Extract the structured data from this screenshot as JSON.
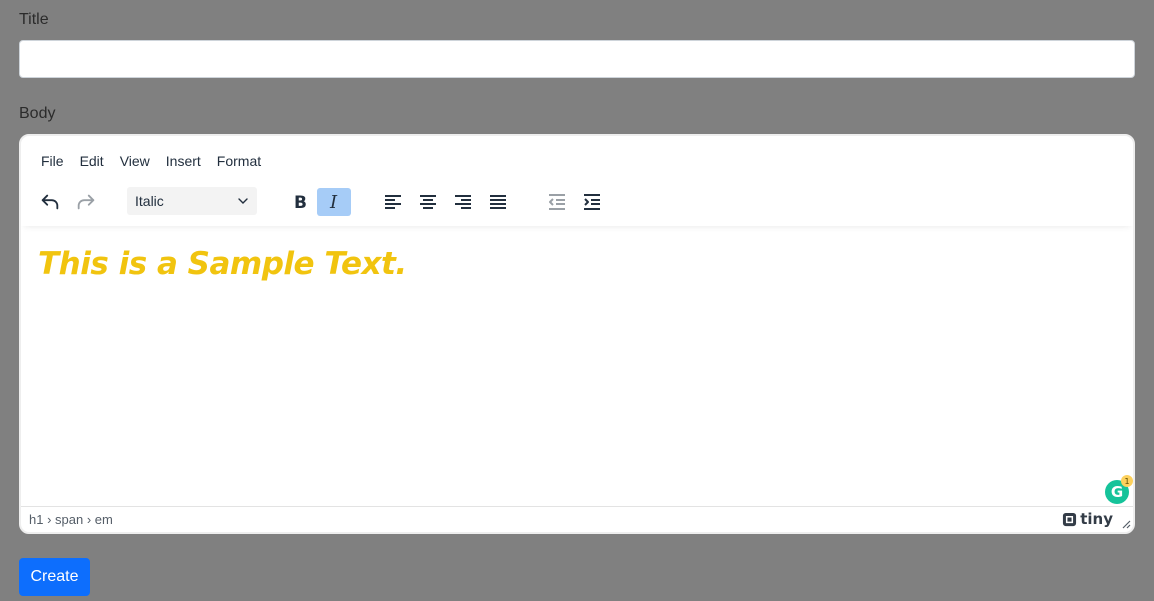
{
  "form": {
    "title_label": "Title",
    "title_value": "",
    "body_label": "Body",
    "create_label": "Create"
  },
  "editor": {
    "menu": [
      "File",
      "Edit",
      "View",
      "Insert",
      "Format"
    ],
    "toolbar": {
      "block_format": "Italic",
      "buttons": [
        {
          "name": "undo-icon",
          "active": false,
          "disabled": false
        },
        {
          "name": "redo-icon",
          "active": false,
          "disabled": true
        },
        {
          "name": "bold-icon",
          "active": false
        },
        {
          "name": "italic-icon",
          "active": true
        },
        {
          "name": "align-left-icon",
          "active": false
        },
        {
          "name": "align-center-icon",
          "active": false
        },
        {
          "name": "align-right-icon",
          "active": false
        },
        {
          "name": "align-justify-icon",
          "active": false
        },
        {
          "name": "outdent-icon",
          "active": false,
          "disabled": true
        },
        {
          "name": "indent-icon",
          "active": false
        }
      ]
    },
    "content": {
      "heading_text": "This is a Sample Text.",
      "heading_color": "#f1c40f"
    },
    "status": {
      "path": "h1 › span › em",
      "brand": "tiny"
    },
    "grammarly": {
      "badge_count": "1",
      "letter": "G"
    }
  },
  "colors": {
    "page_bg": "#808080",
    "primary": "#0d6efd",
    "active_button": "#a6ccf7"
  }
}
